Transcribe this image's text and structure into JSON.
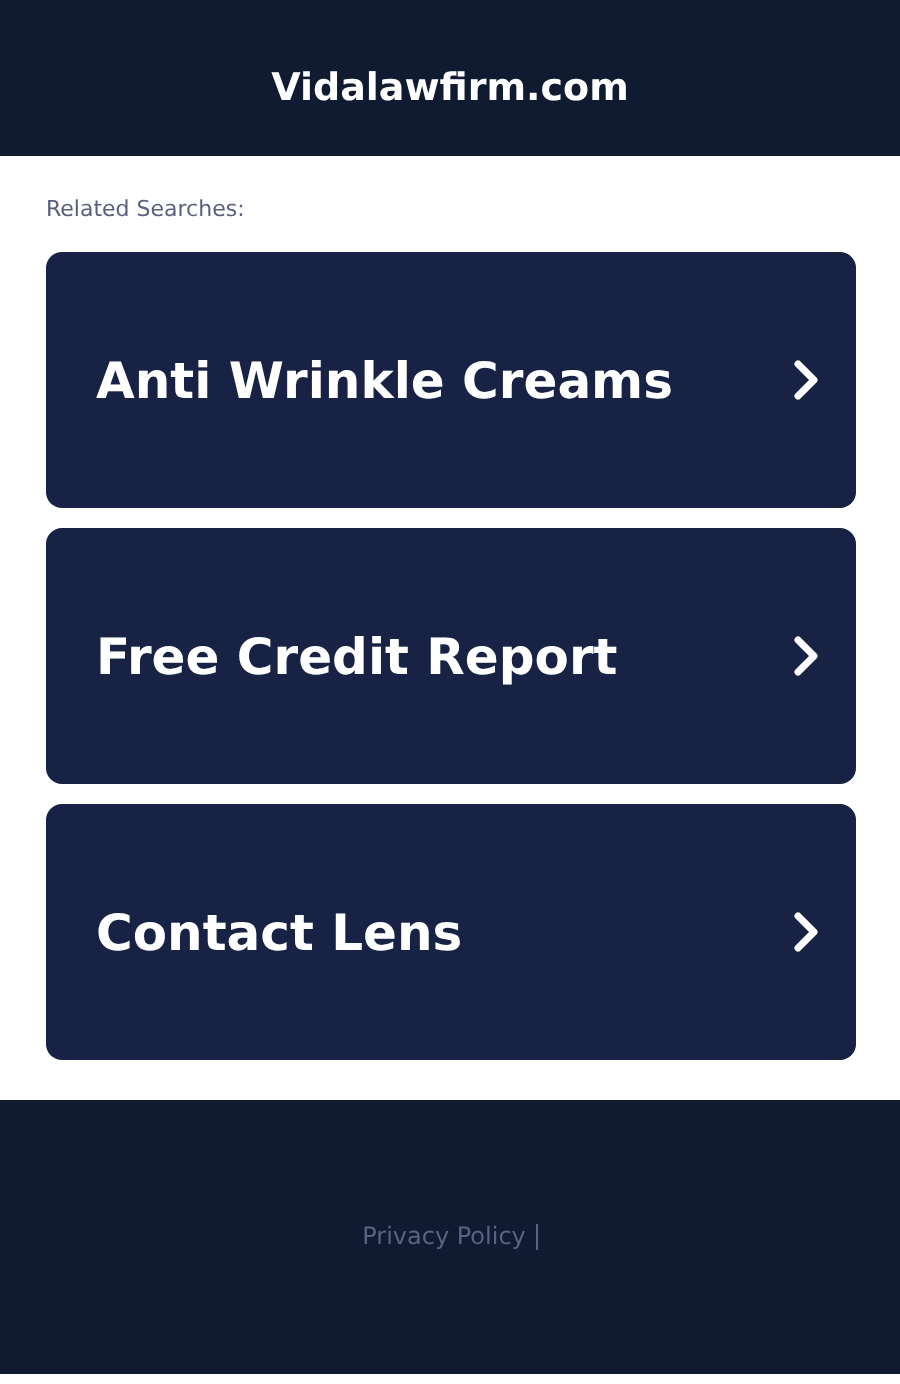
{
  "header": {
    "title": "Vidalawfirm.com"
  },
  "related_label": "Related Searches:",
  "searches": [
    {
      "label": "Anti Wrinkle Creams"
    },
    {
      "label": "Free Credit Report"
    },
    {
      "label": "Contact Lens"
    }
  ],
  "footer": {
    "links": [
      "Privacy Policy"
    ]
  }
}
